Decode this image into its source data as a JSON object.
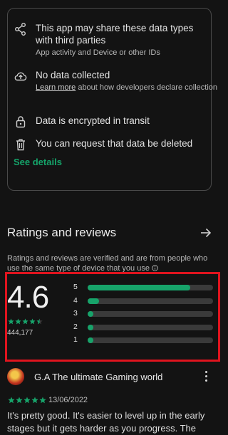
{
  "data_safety": {
    "items": [
      {
        "icon": "share-icon",
        "text": "This app may share these data types with third parties",
        "sub": "App activity and Device or other IDs"
      },
      {
        "icon": "cloud-upload-icon",
        "text": "No data collected",
        "sub_link": "Learn more",
        "sub_rest": " about how developers declare collection"
      },
      {
        "icon": "lock-icon",
        "text": "Data is encrypted in transit"
      },
      {
        "icon": "trash-icon",
        "text": "You can request that data be deleted"
      }
    ],
    "see_details": "See details"
  },
  "ratings": {
    "title": "Ratings and reviews",
    "verified": "Ratings and reviews are verified and are from people who use the same type of device that you use",
    "score": "4.6",
    "stars_filled": 4.5,
    "count": "444,177",
    "histogram": [
      {
        "label": "5",
        "fraction": 0.82
      },
      {
        "label": "4",
        "fraction": 0.09
      },
      {
        "label": "3",
        "fraction": 0.04
      },
      {
        "label": "2",
        "fraction": 0.04
      },
      {
        "label": "1",
        "fraction": 0.04
      }
    ]
  },
  "review": {
    "author": "G.A The ultimate Gaming world",
    "stars": 5,
    "date": "13/06/2022",
    "text": "It's pretty good. It's easier to level up in the early stages but it gets harder as you progress. The"
  },
  "colors": {
    "accent": "#17a36a",
    "highlight_box": "#e0141e"
  }
}
